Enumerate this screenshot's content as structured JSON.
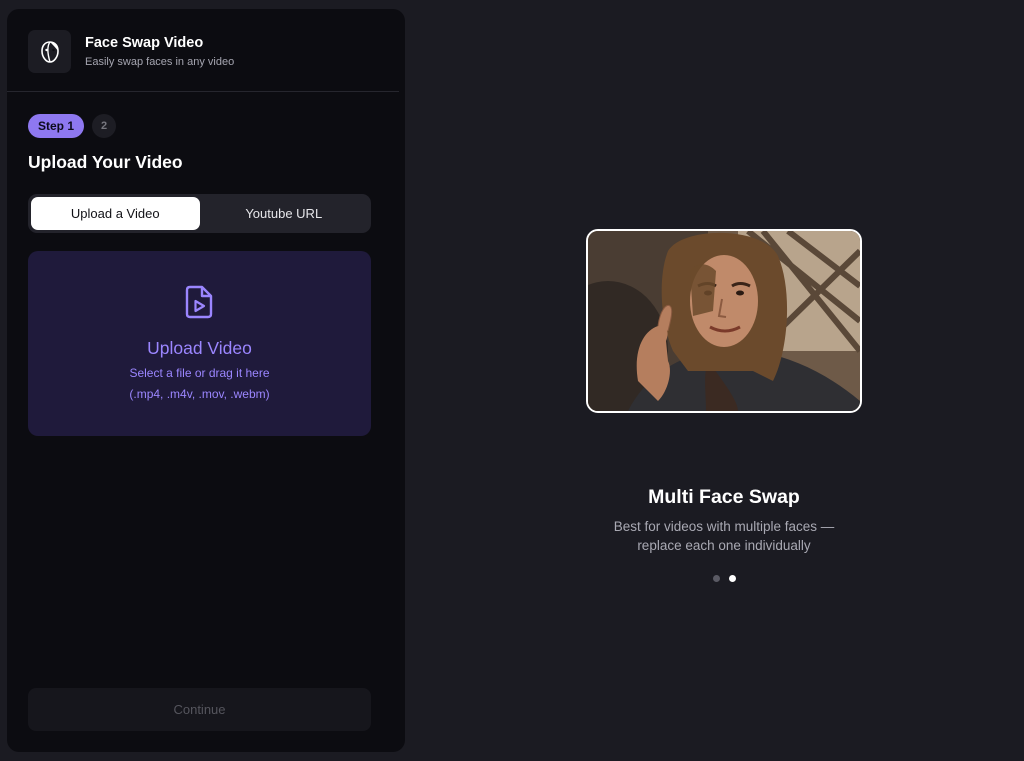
{
  "app": {
    "title": "Face Swap Video",
    "subtitle": "Easily swap faces in any video",
    "logo_icon": "face-mask-icon"
  },
  "steps": {
    "current_label": "Step 1",
    "next_label": "2"
  },
  "section": {
    "title": "Upload Your Video"
  },
  "tabs": [
    {
      "label": "Upload a Video",
      "active": true
    },
    {
      "label": "Youtube URL",
      "active": false
    }
  ],
  "dropzone": {
    "icon": "file-video-icon",
    "title": "Upload Video",
    "hint": "Select a file or drag it here",
    "formats": "(.mp4, .m4v, .mov, .webm)"
  },
  "continue_label": "Continue",
  "showcase": {
    "title": "Multi Face Swap",
    "description_line1": "Best for videos with multiple faces —",
    "description_line2": "replace each one individually",
    "slides": 2,
    "active_slide": 2
  },
  "colors": {
    "accent": "#8e78f0",
    "accent_text": "#9b86ff",
    "panel_bg": "#0c0c11",
    "page_bg": "#1b1b22",
    "dropzone_bg": "#1f1a3b"
  }
}
